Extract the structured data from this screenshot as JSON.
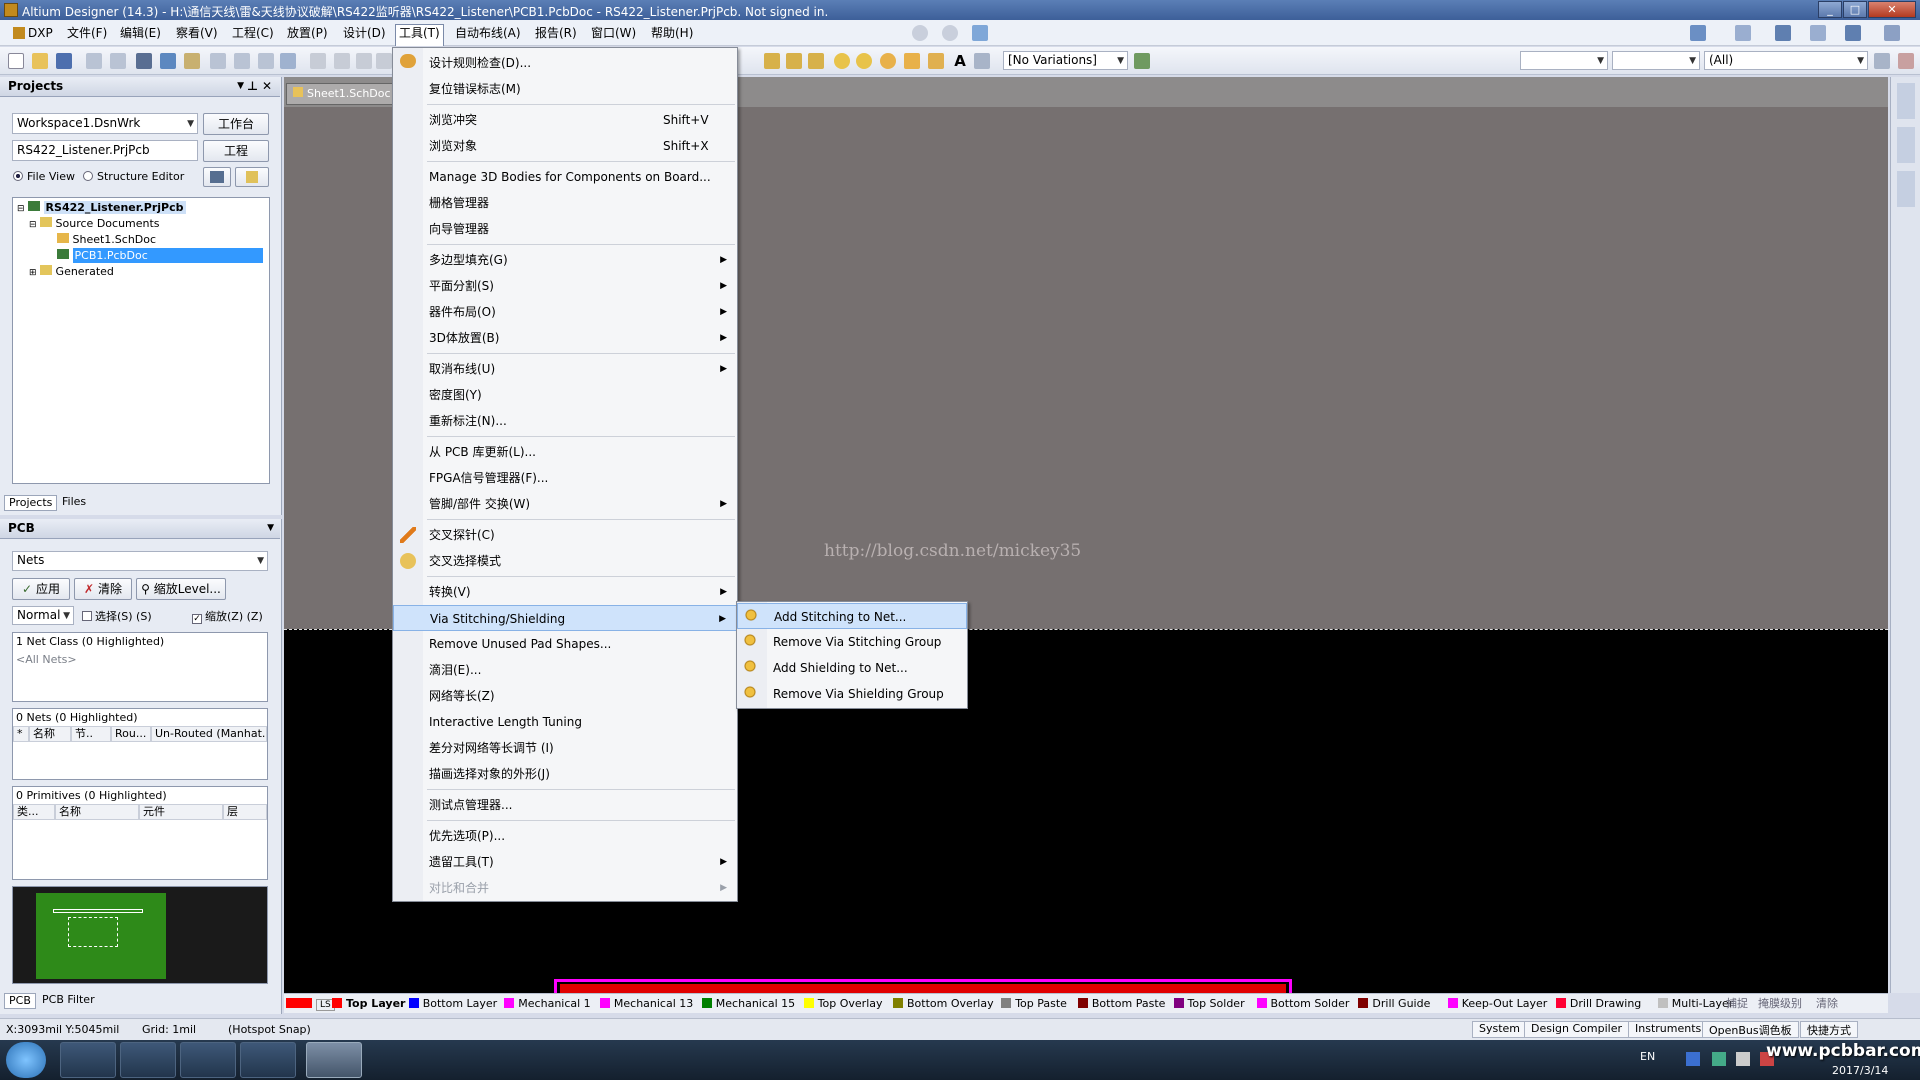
{
  "window": {
    "title": "Altium Designer (14.3) - H:\\通信天线\\雷&天线协议破解\\RS422监听器\\RS422_Listener\\PCB1.PcbDoc - RS422_Listener.PrjPcb. Not signed in."
  },
  "menubar": {
    "items": [
      "DXP",
      "文件(F)",
      "编辑(E)",
      "察看(V)",
      "工程(C)",
      "放置(P)",
      "设计(D)",
      "工具(T)",
      "自动布线(A)",
      "报告(R)",
      "窗口(W)",
      "帮助(H)"
    ]
  },
  "toolbar": {
    "variations": "[No Variations]",
    "filter": "(All)"
  },
  "projects_panel": {
    "title": "Projects",
    "workspace": "Workspace1.DsnWrk",
    "workspace_btn": "工作台",
    "project": "RS422_Listener.PrjPcb",
    "project_btn": "工程",
    "file_view": "File View",
    "structure_editor": "Structure Editor",
    "tree": {
      "root": "RS422_Listener.PrjPcb",
      "source": "Source Documents",
      "sheet": "Sheet1.SchDoc",
      "pcb": "PCB1.PcbDoc",
      "generated": "Generated"
    },
    "tabs": [
      "Projects",
      "Files"
    ]
  },
  "pcb_panel": {
    "title": "PCB",
    "mode": "Nets",
    "apply": "应用",
    "clear": "清除",
    "zoom_level": "缩放Level...",
    "normal": "Normal",
    "select_label": "选择(S) (S)",
    "zoom_label": "缩放(Z) (Z)",
    "net_class": "1 Net Class (0 Highlighted)",
    "all_nets": "<All Nets>",
    "nets_header": "0 Nets (0 Highlighted)",
    "nets_cols": [
      "*",
      "名称",
      "节..",
      "Rou...",
      "Un-Routed (Manhat..."
    ],
    "prims_header": "0 Primitives (0 Highlighted)",
    "prims_cols": [
      "类...",
      "名称",
      "元件",
      "层"
    ],
    "bottom_tabs": [
      "PCB",
      "PCB Filter"
    ]
  },
  "doc_tab": "Sheet1.SchDoc",
  "watermark": "http://blog.csdn.net/mickey35",
  "tools_menu": {
    "items": [
      {
        "label": "设计规则检查(D)..."
      },
      {
        "label": "复位错误标志(M)"
      },
      {
        "sep": true
      },
      {
        "label": "浏览冲突",
        "shortcut": "Shift+V"
      },
      {
        "label": "浏览对象",
        "shortcut": "Shift+X"
      },
      {
        "sep": true
      },
      {
        "label": "Manage 3D Bodies for Components on Board..."
      },
      {
        "label": "栅格管理器"
      },
      {
        "label": "向导管理器"
      },
      {
        "sep": true
      },
      {
        "label": "多边型填充(G)",
        "sub": true
      },
      {
        "label": "平面分割(S)",
        "sub": true
      },
      {
        "label": "器件布局(O)",
        "sub": true
      },
      {
        "label": "3D体放置(B)",
        "sub": true
      },
      {
        "sep": true
      },
      {
        "label": "取消布线(U)",
        "sub": true
      },
      {
        "label": "密度图(Y)"
      },
      {
        "label": "重新标注(N)..."
      },
      {
        "sep": true
      },
      {
        "label": "从 PCB 库更新(L)..."
      },
      {
        "label": "FPGA信号管理器(F)..."
      },
      {
        "label": "管脚/部件 交换(W)",
        "sub": true
      },
      {
        "sep": true
      },
      {
        "label": "交叉探针(C)",
        "icon": "probe"
      },
      {
        "label": "交叉选择模式",
        "icon": "select"
      },
      {
        "sep": true
      },
      {
        "label": "转换(V)",
        "sub": true
      },
      {
        "label": "Via Stitching/Shielding",
        "sub": true,
        "highlight": true
      },
      {
        "label": "Remove Unused Pad Shapes..."
      },
      {
        "label": "滴泪(E)..."
      },
      {
        "label": "网络等长(Z)"
      },
      {
        "label": "Interactive Length Tuning"
      },
      {
        "label": "差分对网络等长调节 (I)"
      },
      {
        "label": "描画选择对象的外形(J)"
      },
      {
        "sep": true
      },
      {
        "label": "测试点管理器..."
      },
      {
        "sep": true
      },
      {
        "label": "优先选项(P)..."
      },
      {
        "label": "遗留工具(T)",
        "sub": true
      },
      {
        "label": "对比和合并",
        "sub": true,
        "disabled": true
      }
    ]
  },
  "submenu": {
    "items": [
      "Add Stitching to Net...",
      "Remove Via Stitching Group",
      "Add Shielding to Net...",
      "Remove Via Shielding Group"
    ]
  },
  "layers": [
    {
      "name": "LS",
      "color": "#ff0000"
    },
    {
      "name": "Top Layer",
      "color": "#ff0000"
    },
    {
      "name": "Bottom Layer",
      "color": "#0000ff"
    },
    {
      "name": "Mechanical 1",
      "color": "#ff00ff"
    },
    {
      "name": "Mechanical 13",
      "color": "#ff00ff"
    },
    {
      "name": "Mechanical 15",
      "color": "#008000"
    },
    {
      "name": "Top Overlay",
      "color": "#ffff00"
    },
    {
      "name": "Bottom Overlay",
      "color": "#808000"
    },
    {
      "name": "Top Paste",
      "color": "#808080"
    },
    {
      "name": "Bottom Paste",
      "color": "#800000"
    },
    {
      "name": "Top Solder",
      "color": "#800080"
    },
    {
      "name": "Bottom Solder",
      "color": "#ff00ff"
    },
    {
      "name": "Drill Guide",
      "color": "#800000"
    },
    {
      "name": "Keep-Out Layer",
      "color": "#ff00ff"
    },
    {
      "name": "Drill Drawing",
      "color": "#ff0033"
    },
    {
      "name": "Multi-Layer",
      "color": "#c0c0c0"
    }
  ],
  "layer_right": {
    "snap": "捕捉",
    "mask": "掩膜级别",
    "clear": "清除"
  },
  "status": {
    "coords": "X:3093mil Y:5045mil",
    "grid": "Grid: 1mil",
    "snap": "(Hotspot Snap)",
    "buttons": [
      "System",
      "Design Compiler",
      "Instruments",
      "OpenBus调色板",
      "快捷方式"
    ]
  },
  "tray": {
    "lang": "EN",
    "date": "2017/3/14",
    "site": "www.pcbbar.com"
  },
  "colors": {
    "canvas_grey": "#767070",
    "board_outline": "#ff00ff",
    "menu_highlight": "#cfe3fb"
  }
}
